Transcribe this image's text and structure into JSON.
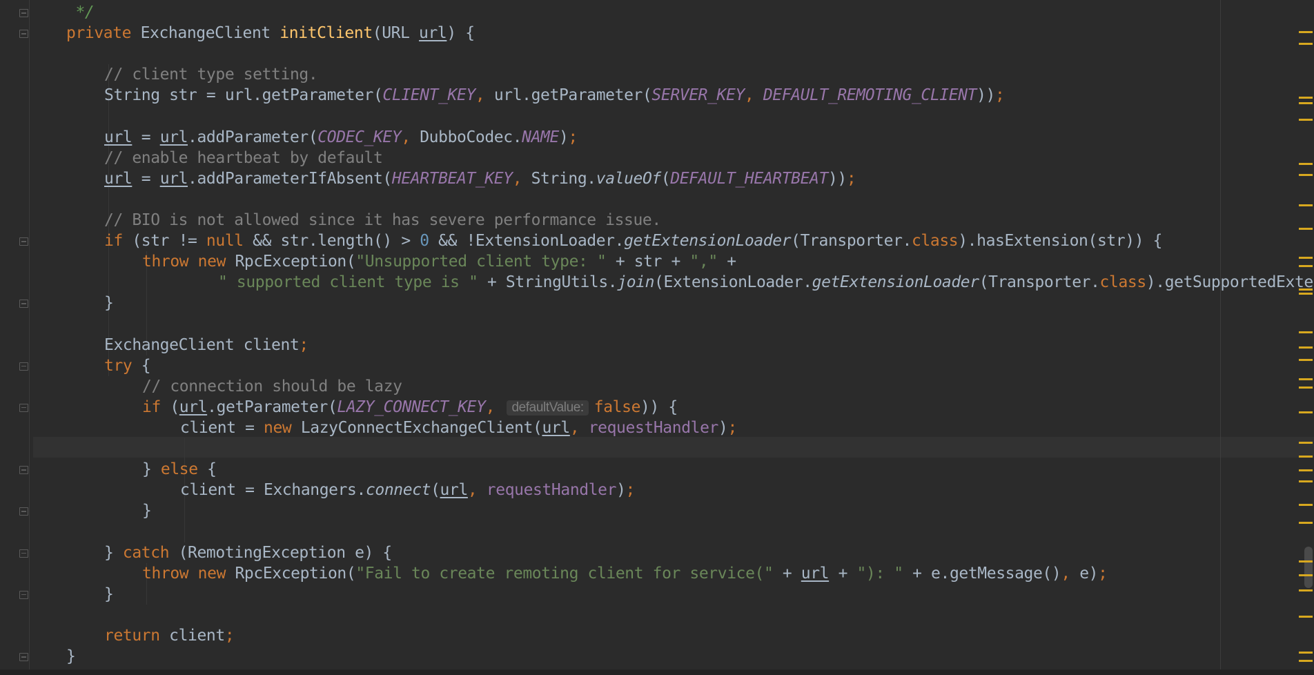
{
  "colors": {
    "background": "#2b2b2b",
    "keyword": "#cc7832",
    "comment": "#808080",
    "method_declaration": "#ffc66d",
    "string": "#6a8759",
    "number": "#6897bb",
    "constant_field": "#9876aa",
    "plain_text": "#a9b7c6",
    "warning_marker": "#d8a81f"
  },
  "code": {
    "lines": [
      {
        "indent": 0,
        "tokens": [
          {
            "t": " */",
            "c": "doc"
          }
        ]
      },
      {
        "indent": 0,
        "tokens": [
          {
            "t": "private ",
            "c": "kw"
          },
          {
            "t": "ExchangeClient "
          },
          {
            "t": "initClient",
            "c": "fn"
          },
          {
            "t": "(URL "
          },
          {
            "t": "url",
            "c": "ul"
          },
          {
            "t": ") {"
          }
        ]
      },
      {
        "indent": 0,
        "tokens": []
      },
      {
        "indent": 1,
        "tokens": [
          {
            "t": "// client type setting.",
            "c": "cm"
          }
        ]
      },
      {
        "indent": 1,
        "tokens": [
          {
            "t": "String str = url.getParameter("
          },
          {
            "t": "CLIENT_KEY",
            "c": "cst"
          },
          {
            "t": ", ",
            "c": "kw"
          },
          {
            "t": "url.getParameter("
          },
          {
            "t": "SERVER_KEY",
            "c": "cst"
          },
          {
            "t": ", ",
            "c": "kw"
          },
          {
            "t": "DEFAULT_REMOTING_CLIENT",
            "c": "cst"
          },
          {
            "t": "))"
          },
          {
            "t": ";",
            "c": "kw"
          }
        ]
      },
      {
        "indent": 0,
        "tokens": []
      },
      {
        "indent": 1,
        "tokens": [
          {
            "t": "url",
            "c": "ul"
          },
          {
            "t": " = "
          },
          {
            "t": "url",
            "c": "ul"
          },
          {
            "t": ".addParameter("
          },
          {
            "t": "CODEC_KEY",
            "c": "cst"
          },
          {
            "t": ", ",
            "c": "kw"
          },
          {
            "t": "DubboCodec."
          },
          {
            "t": "NAME",
            "c": "cst"
          },
          {
            "t": ")"
          },
          {
            "t": ";",
            "c": "kw"
          }
        ]
      },
      {
        "indent": 1,
        "tokens": [
          {
            "t": "// enable heartbeat by default",
            "c": "cm"
          }
        ]
      },
      {
        "indent": 1,
        "tokens": [
          {
            "t": "url",
            "c": "ul"
          },
          {
            "t": " = "
          },
          {
            "t": "url",
            "c": "ul"
          },
          {
            "t": ".addParameterIfAbsent("
          },
          {
            "t": "HEARTBEAT_KEY",
            "c": "cst"
          },
          {
            "t": ", ",
            "c": "kw"
          },
          {
            "t": "String."
          },
          {
            "t": "valueOf",
            "c": "sti"
          },
          {
            "t": "("
          },
          {
            "t": "DEFAULT_HEARTBEAT",
            "c": "cst"
          },
          {
            "t": "))"
          },
          {
            "t": ";",
            "c": "kw"
          }
        ]
      },
      {
        "indent": 0,
        "tokens": []
      },
      {
        "indent": 1,
        "tokens": [
          {
            "t": "// BIO is not allowed since it has severe performance issue.",
            "c": "cm"
          }
        ]
      },
      {
        "indent": 1,
        "tokens": [
          {
            "t": "if ",
            "c": "kw"
          },
          {
            "t": "(str != "
          },
          {
            "t": "null ",
            "c": "kw"
          },
          {
            "t": "&& str.length() > "
          },
          {
            "t": "0",
            "c": "num"
          },
          {
            "t": " && !ExtensionLoader."
          },
          {
            "t": "getExtensionLoader",
            "c": "sti"
          },
          {
            "t": "(Transporter."
          },
          {
            "t": "class",
            "c": "kw"
          },
          {
            "t": ").hasExtension(str)) {"
          }
        ]
      },
      {
        "indent": 2,
        "tokens": [
          {
            "t": "throw new ",
            "c": "kw"
          },
          {
            "t": "RpcException("
          },
          {
            "t": "\"Unsupported client type: \"",
            "c": "st"
          },
          {
            "t": " + str + "
          },
          {
            "t": "\",\"",
            "c": "st"
          },
          {
            "t": " +"
          }
        ]
      },
      {
        "indent": 4,
        "tokens": [
          {
            "t": "\" supported client type is \"",
            "c": "st"
          },
          {
            "t": " + StringUtils."
          },
          {
            "t": "join",
            "c": "sti"
          },
          {
            "t": "(ExtensionLoader."
          },
          {
            "t": "getExtensionLoader",
            "c": "sti"
          },
          {
            "t": "(Transporter."
          },
          {
            "t": "class",
            "c": "kw"
          },
          {
            "t": ").getSupportedExtensions()"
          }
        ]
      },
      {
        "indent": 1,
        "tokens": [
          {
            "t": "}"
          }
        ]
      },
      {
        "indent": 0,
        "tokens": []
      },
      {
        "indent": 1,
        "tokens": [
          {
            "t": "ExchangeClient client"
          },
          {
            "t": ";",
            "c": "kw"
          }
        ]
      },
      {
        "indent": 1,
        "tokens": [
          {
            "t": "try ",
            "c": "kw"
          },
          {
            "t": "{"
          }
        ]
      },
      {
        "indent": 2,
        "tokens": [
          {
            "t": "// connection should be lazy",
            "c": "cm"
          }
        ]
      },
      {
        "indent": 2,
        "tokens": [
          {
            "t": "if ",
            "c": "kw"
          },
          {
            "t": "("
          },
          {
            "t": "url",
            "c": "ul"
          },
          {
            "t": ".getParameter("
          },
          {
            "t": "LAZY_CONNECT_KEY",
            "c": "cst"
          },
          {
            "t": ", ",
            "c": "kw"
          },
          {
            "t": "defaultValue:",
            "c": "hint"
          },
          {
            "t": "false",
            "c": "kw"
          },
          {
            "t": ")) {"
          }
        ]
      },
      {
        "indent": 3,
        "tokens": [
          {
            "t": "client = "
          },
          {
            "t": "new ",
            "c": "kw"
          },
          {
            "t": "LazyConnectExchangeClient("
          },
          {
            "t": "url",
            "c": "ul"
          },
          {
            "t": ", ",
            "c": "kw"
          },
          {
            "t": "requestHandler",
            "c": "fld"
          },
          {
            "t": ")"
          },
          {
            "t": ";",
            "c": "kw"
          }
        ]
      },
      {
        "indent": 0,
        "tokens": []
      },
      {
        "indent": 2,
        "tokens": [
          {
            "t": "} "
          },
          {
            "t": "else ",
            "c": "kw"
          },
          {
            "t": "{"
          }
        ]
      },
      {
        "indent": 3,
        "tokens": [
          {
            "t": "client = Exchangers."
          },
          {
            "t": "connect",
            "c": "sti"
          },
          {
            "t": "("
          },
          {
            "t": "url",
            "c": "ul"
          },
          {
            "t": ", ",
            "c": "kw"
          },
          {
            "t": "requestHandler",
            "c": "fld"
          },
          {
            "t": ")"
          },
          {
            "t": ";",
            "c": "kw"
          }
        ]
      },
      {
        "indent": 2,
        "tokens": [
          {
            "t": "}"
          }
        ]
      },
      {
        "indent": 0,
        "tokens": []
      },
      {
        "indent": 1,
        "tokens": [
          {
            "t": "} "
          },
          {
            "t": "catch ",
            "c": "kw"
          },
          {
            "t": "(RemotingException e) {"
          }
        ]
      },
      {
        "indent": 2,
        "tokens": [
          {
            "t": "throw new ",
            "c": "kw"
          },
          {
            "t": "RpcException("
          },
          {
            "t": "\"Fail to create remoting client for service(\"",
            "c": "st"
          },
          {
            "t": " + "
          },
          {
            "t": "url",
            "c": "ul"
          },
          {
            "t": " + "
          },
          {
            "t": "\"): \"",
            "c": "st"
          },
          {
            "t": " + e.getMessage()"
          },
          {
            "t": ", ",
            "c": "kw"
          },
          {
            "t": "e)"
          },
          {
            "t": ";",
            "c": "kw"
          }
        ]
      },
      {
        "indent": 1,
        "tokens": [
          {
            "t": "}"
          }
        ]
      },
      {
        "indent": 0,
        "tokens": []
      },
      {
        "indent": 1,
        "tokens": [
          {
            "t": "return ",
            "c": "kw"
          },
          {
            "t": "client"
          },
          {
            "t": ";",
            "c": "kw"
          }
        ]
      },
      {
        "indent": 0,
        "tokens": [
          {
            "t": "}"
          }
        ]
      }
    ]
  }
}
